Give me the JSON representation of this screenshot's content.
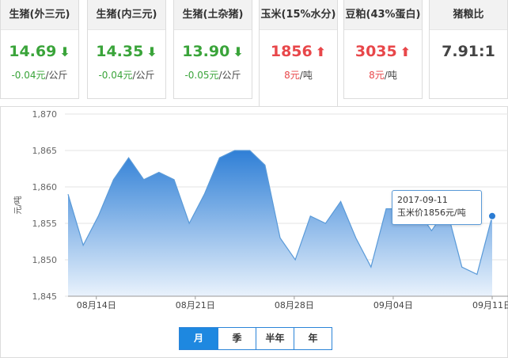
{
  "cards": [
    {
      "title": "生猪(外三元)",
      "price": "14.69",
      "direction": "down",
      "arrow": "⬇",
      "change": "-0.04元",
      "unit": "/公斤"
    },
    {
      "title": "生猪(内三元)",
      "price": "14.35",
      "direction": "down",
      "arrow": "⬇",
      "change": "-0.04元",
      "unit": "/公斤"
    },
    {
      "title": "生猪(土杂猪)",
      "price": "13.90",
      "direction": "down",
      "arrow": "⬇",
      "change": "-0.05元",
      "unit": "/公斤"
    },
    {
      "title": "玉米(15%水分)",
      "price": "1856",
      "direction": "up",
      "arrow": "⬆",
      "change": "8元",
      "unit": "/吨"
    },
    {
      "title": "豆粕(43%蛋白)",
      "price": "3035",
      "direction": "up",
      "arrow": "⬆",
      "change": "8元",
      "unit": "/吨"
    },
    {
      "title": "猪粮比",
      "price": "7.91:1",
      "direction": "flat",
      "arrow": "",
      "change": "",
      "unit": ""
    }
  ],
  "tooltip": {
    "date": "2017-09-11",
    "text": "玉米价1856元/吨"
  },
  "range_tabs": [
    "月",
    "季",
    "半年",
    "年"
  ],
  "active_tab": "月",
  "colors": {
    "up": "#e8474a",
    "down": "#3aa43a",
    "accent": "#1e88e0",
    "area_top": "#2f7fd6",
    "area_bottom": "#e9f2fc"
  },
  "chart_data": {
    "type": "area",
    "ylabel": "元/吨",
    "ylim": [
      1845,
      1870
    ],
    "yticks": [
      "1,845",
      "1,850",
      "1,855",
      "1,860",
      "1,865",
      "1,870"
    ],
    "xticks": [
      "08月14日",
      "08月21日",
      "08月28日",
      "09月04日",
      "09月11日"
    ],
    "grid": true,
    "series": [
      {
        "values": [
          1859,
          1852,
          1856,
          1861,
          1864,
          1861,
          1862,
          1861,
          1855,
          1859,
          1864,
          1865,
          1865,
          1863,
          1853,
          1850,
          1856,
          1855,
          1858,
          1853,
          1849,
          1857,
          1857,
          1857,
          1854,
          1857,
          1849,
          1848,
          1856
        ]
      }
    ]
  }
}
